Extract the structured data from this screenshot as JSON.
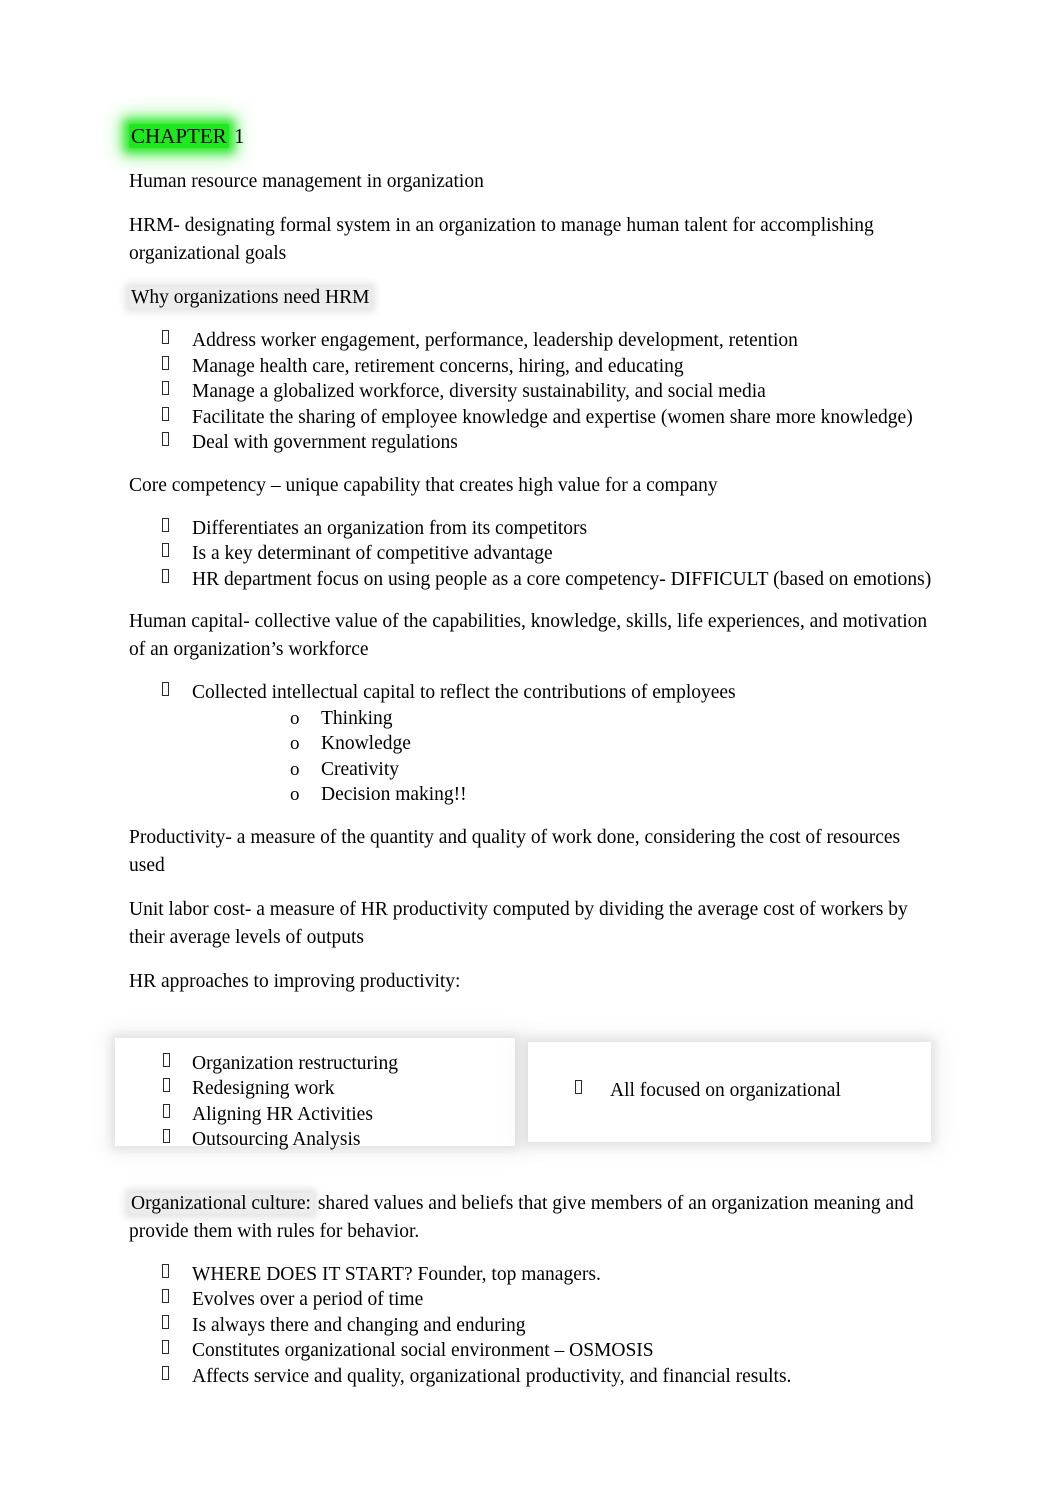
{
  "document": {
    "title_prefix": "CHAPTER",
    "title_suffix": " 1",
    "subtitle": "Human resource management in organization",
    "hrm_definition": "HRM- designating formal system in an organization to manage human talent for accomplishing organizational goals",
    "why_heading": "Why organizations need HRM",
    "why_bullets": [
      "Address worker engagement, performance, leadership development, retention",
      "Manage health care, retirement concerns, hiring, and educating",
      "Manage a globalized workforce, diversity sustainability, and social media",
      "Facilitate the sharing of employee knowledge and expertise (women share more knowledge)",
      "Deal with government regulations"
    ],
    "core_competency_def": "Core competency –  unique capability that creates high value for a company",
    "core_competency_bullets": [
      "Differentiates an organization from its competitors",
      "Is a key determinant of competitive advantage",
      "HR department focus on using people as a core competency- DIFFICULT (based on emotions)"
    ],
    "human_capital_def": "Human capital- collective value of the capabilities, knowledge, skills, life experiences, and motivation  of an organization’s workforce",
    "human_capital_bullet": "Collected intellectual capital to reflect the contributions of employees",
    "human_capital_subbullets": [
      "Thinking",
      "Knowledge",
      "Creativity",
      "Decision making!!"
    ],
    "productivity_def": "Productivity- a measure of the quantity and quality of work done, considering the cost of resources used",
    "unit_labor_cost_def": "Unit labor cost- a measure of HR productivity computed by dividing the average cost of workers by their average levels of outputs",
    "hr_approaches_heading": "HR approaches to improving productivity:",
    "approaches_box_left": [
      "Organization restructuring",
      "Redesigning work",
      "Aligning HR Activities",
      "Outsourcing Analysis"
    ],
    "approaches_box_right": [
      "All focused on organizational"
    ],
    "org_culture_label": "Organizational culture:",
    "org_culture_rest": " shared values and beliefs that give members of an organization meaning and provide them with rules for behavior.",
    "org_culture_bullets": [
      "WHERE DOES IT START? Founder, top managers.",
      "Evolves over a period of time",
      "Is always there and changing and enduring",
      "Constitutes organizational social environment – OSMOSIS",
      "Affects service and quality, organizational productivity, and financial results."
    ],
    "sub_bullet_marker": "o"
  },
  "colors": {
    "highlight_green": "#1fe81f",
    "highlight_gray": "#ececec",
    "text": "#000000",
    "page_background": "#ffffff"
  }
}
